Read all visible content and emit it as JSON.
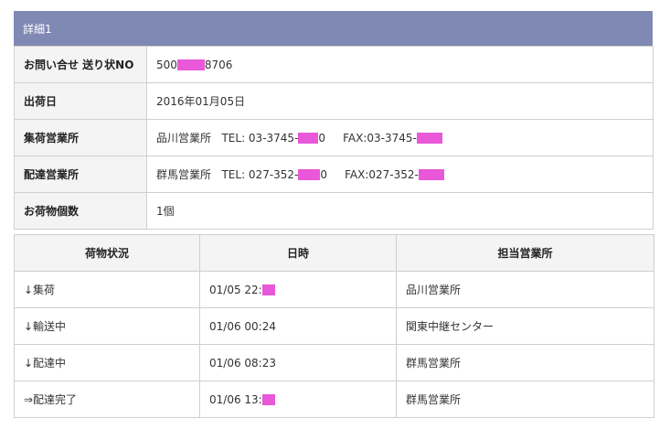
{
  "header": {
    "title": "詳細1"
  },
  "colors": {
    "header_bg": "#8088b4",
    "redaction": "#e858d8"
  },
  "detail": {
    "tracking": {
      "label": "お問い合せ 送り状NO",
      "value_prefix": "500",
      "value_suffix": "8706"
    },
    "ship_date": {
      "label": "出荷日",
      "value": "2016年01月05日"
    },
    "pickup_office": {
      "label": "集荷営業所",
      "name": "品川営業所",
      "tel_prefix": "TEL: 03-3745-",
      "tel_suffix": "0",
      "fax_prefix": "FAX:03-3745-"
    },
    "delivery_office": {
      "label": "配達営業所",
      "name": "群馬営業所",
      "tel_prefix": "TEL: 027-352-",
      "tel_suffix": "0",
      "fax_prefix": "FAX:027-352-"
    },
    "quantity": {
      "label": "お荷物個数",
      "value": "1個"
    }
  },
  "history": {
    "headers": [
      "荷物状況",
      "日時",
      "担当営業所"
    ],
    "rows": [
      {
        "status": "↓集荷",
        "datetime": "01/05 22:",
        "office": "品川営業所"
      },
      {
        "status": "↓輸送中",
        "datetime": "01/06 00:24",
        "office": "関東中継センター"
      },
      {
        "status": "↓配達中",
        "datetime": "01/06 08:23",
        "office": "群馬営業所"
      },
      {
        "status": "⇒配達完了",
        "datetime": "01/06 13:",
        "office": "群馬営業所"
      }
    ]
  }
}
